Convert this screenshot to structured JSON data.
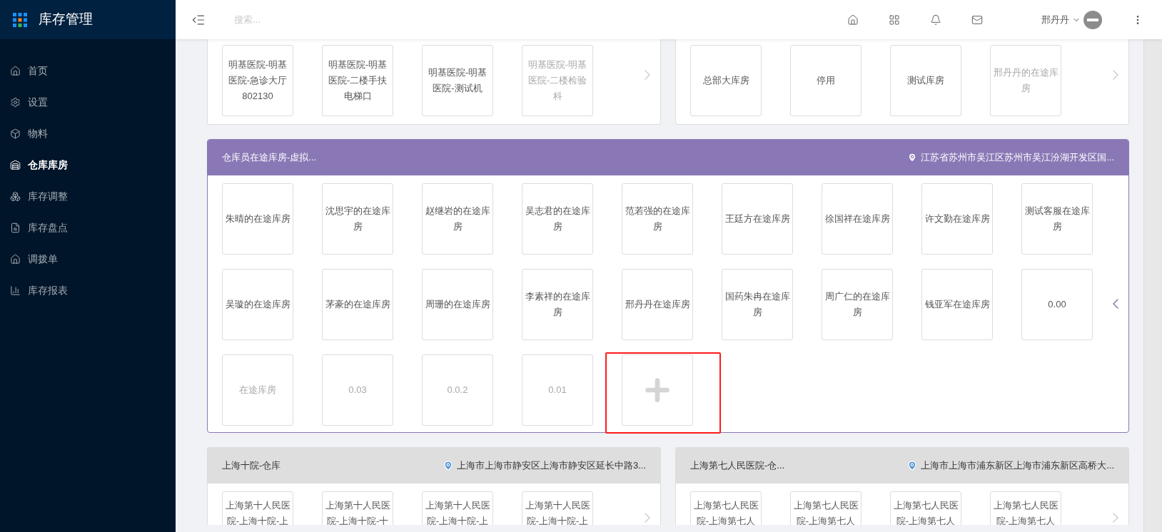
{
  "app": {
    "title": "库存管理"
  },
  "sidebar": {
    "items": [
      {
        "label": "首页",
        "selected": false
      },
      {
        "label": "设置",
        "selected": false
      },
      {
        "label": "物料",
        "selected": false
      },
      {
        "label": "仓库库房",
        "selected": true
      },
      {
        "label": "库存调整",
        "selected": false
      },
      {
        "label": "库存盘点",
        "selected": false
      },
      {
        "label": "调拨单",
        "selected": false
      },
      {
        "label": "库存报表",
        "selected": false
      }
    ]
  },
  "topbar": {
    "search": {
      "placeholder": "搜索..."
    },
    "user": "邢丹丹"
  },
  "panel_rows": [
    {
      "panels": [
        {
          "selected": false,
          "cards": [
            {
              "label": "明基医院-明基医院-急诊大厅802130",
              "disabled": false
            },
            {
              "label": "明基医院-明基医院-二楼手扶电梯口",
              "disabled": false
            },
            {
              "label": "明基医院-明基医院-测试机",
              "disabled": false
            },
            {
              "label": "明基医院-明基医院-二楼检验科",
              "disabled": true
            }
          ]
        },
        {
          "selected": false,
          "cards": [
            {
              "label": "总部大库房",
              "disabled": false
            },
            {
              "label": "停用",
              "disabled": false
            },
            {
              "label": "测试库房",
              "disabled": false
            },
            {
              "label": "邢丹丹的在途库房",
              "disabled": true
            }
          ]
        }
      ]
    },
    {
      "panels": [
        {
          "selected": true,
          "title": "仓库员在途库房-虚拟...",
          "address": "江苏省苏州市吴江区苏州市吴江汾湖开发区国...",
          "add_card": {
            "highlighted": true
          },
          "cards": [
            {
              "label": "朱晴的在途库房",
              "disabled": false
            },
            {
              "label": "沈思宇的在途库房",
              "disabled": false
            },
            {
              "label": "赵继岩的在途库房",
              "disabled": false
            },
            {
              "label": "吴志君的在途库房",
              "disabled": false
            },
            {
              "label": "范若强的在途库房",
              "disabled": false
            },
            {
              "label": "王廷方在途库房",
              "disabled": false
            },
            {
              "label": "徐国祥在途库房",
              "disabled": false
            },
            {
              "label": "许文勤在途库房",
              "disabled": false
            },
            {
              "label": "测试客服在途库房",
              "disabled": false
            },
            {
              "label": "吴璇的在途库房",
              "disabled": false
            },
            {
              "label": "茅豪的在途库房",
              "disabled": false
            },
            {
              "label": "周珊的在途库房",
              "disabled": false
            },
            {
              "label": "李素祥的在途库房",
              "disabled": false
            },
            {
              "label": "邢丹丹在途库房",
              "disabled": false
            },
            {
              "label": "国药朱冉在途库房",
              "disabled": false
            },
            {
              "label": "周广仁的在途库房",
              "disabled": false
            },
            {
              "label": "钱亚军在途库房",
              "disabled": false
            },
            {
              "label": "0.00",
              "disabled": false
            },
            {
              "label": "在途库房",
              "disabled": true
            },
            {
              "label": "0.03",
              "disabled": true
            },
            {
              "label": "0.0.2",
              "disabled": true
            },
            {
              "label": "0.01",
              "disabled": true
            }
          ]
        }
      ]
    },
    {
      "panels": [
        {
          "selected": false,
          "title": "上海十院-仓库",
          "address": "上海市上海市静安区上海市静安区延长中路3...",
          "cards": [
            {
              "label": "上海第十人民医院-上海十院-上",
              "disabled": false
            },
            {
              "label": "上海第十人民医院-上海十院-十",
              "disabled": false
            },
            {
              "label": "上海第十人民医院-上海十院-上",
              "disabled": false
            },
            {
              "label": "上海第十人民医院-上海十院-上",
              "disabled": false
            }
          ]
        },
        {
          "selected": false,
          "title": "上海第七人民医院-仓...",
          "address": "上海市上海市浦东新区上海市浦东新区高桥大...",
          "cards": [
            {
              "label": "上海第七人民医院-上海第七人",
              "disabled": false
            },
            {
              "label": "上海第七人民医院-上海第七人",
              "disabled": false
            },
            {
              "label": "上海第七人民医院-上海第七人",
              "disabled": false
            },
            {
              "label": "上海第七人民医院-上海第七人",
              "disabled": false
            }
          ]
        }
      ]
    }
  ]
}
